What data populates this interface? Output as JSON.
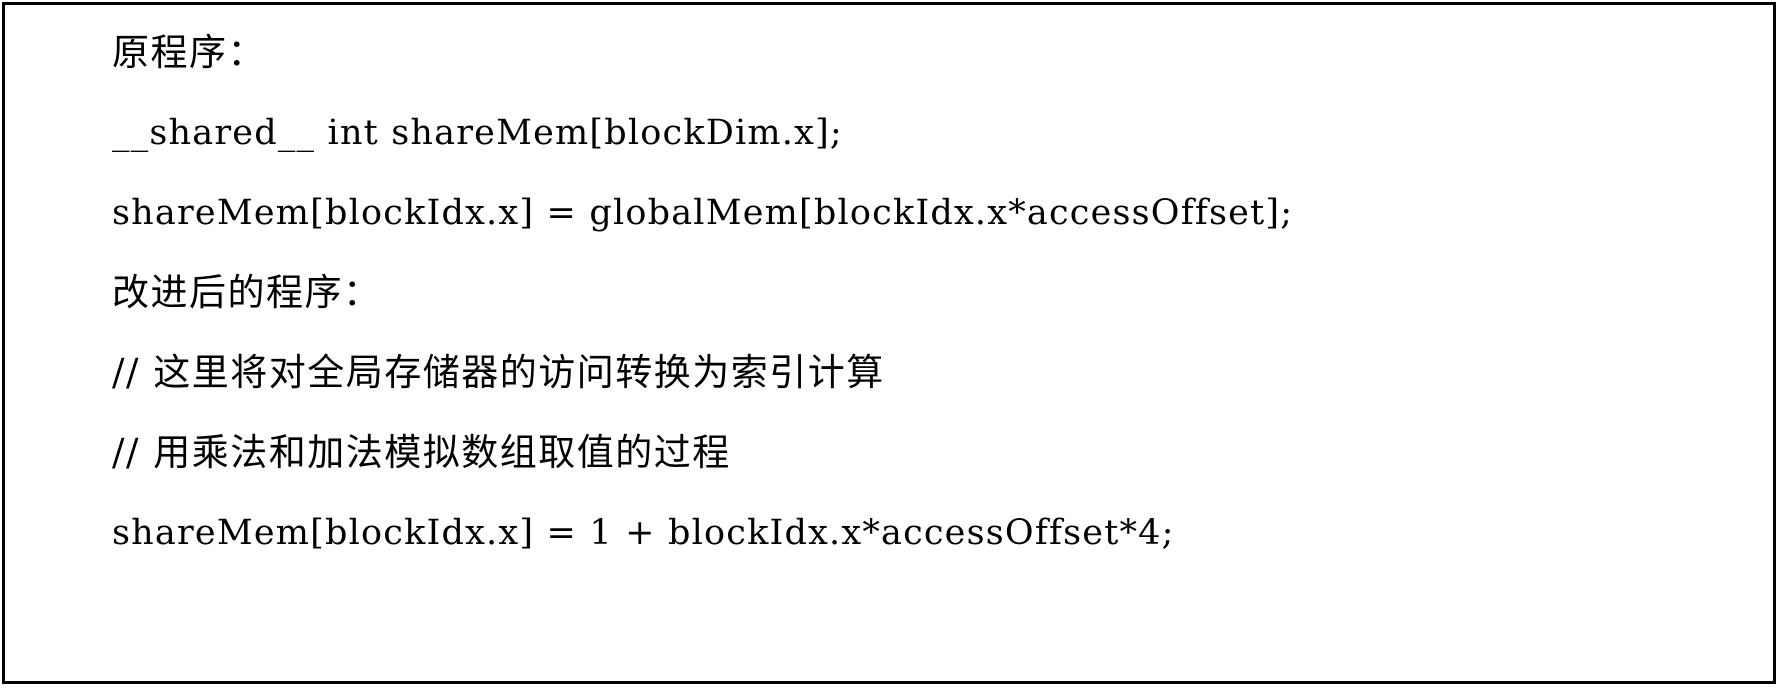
{
  "figure": {
    "border_color": "#000000",
    "background_color": "#ffffff",
    "text_color": "#000000"
  },
  "code_listing": {
    "lines": [
      {
        "id": "original-heading",
        "kind": "cjk",
        "text": "原程序："
      },
      {
        "id": "shared-decl",
        "kind": "code",
        "text": "__shared__ int shareMem[blockDim.x];"
      },
      {
        "id": "original-assign",
        "kind": "code",
        "text": "shareMem[blockIdx.x] = globalMem[blockIdx.x*accessOffset];"
      },
      {
        "id": "improved-heading",
        "kind": "cjk",
        "text": "改进后的程序："
      },
      {
        "id": "comment-index-calc",
        "kind": "comment",
        "text": "// 这里将对全局存储器的访问转换为索引计算"
      },
      {
        "id": "comment-mul-add",
        "kind": "comment",
        "text": "// 用乘法和加法模拟数组取值的过程"
      },
      {
        "id": "improved-assign",
        "kind": "code",
        "text": "shareMem[blockIdx.x] = 1 + blockIdx.x*accessOffset*4;"
      }
    ]
  }
}
